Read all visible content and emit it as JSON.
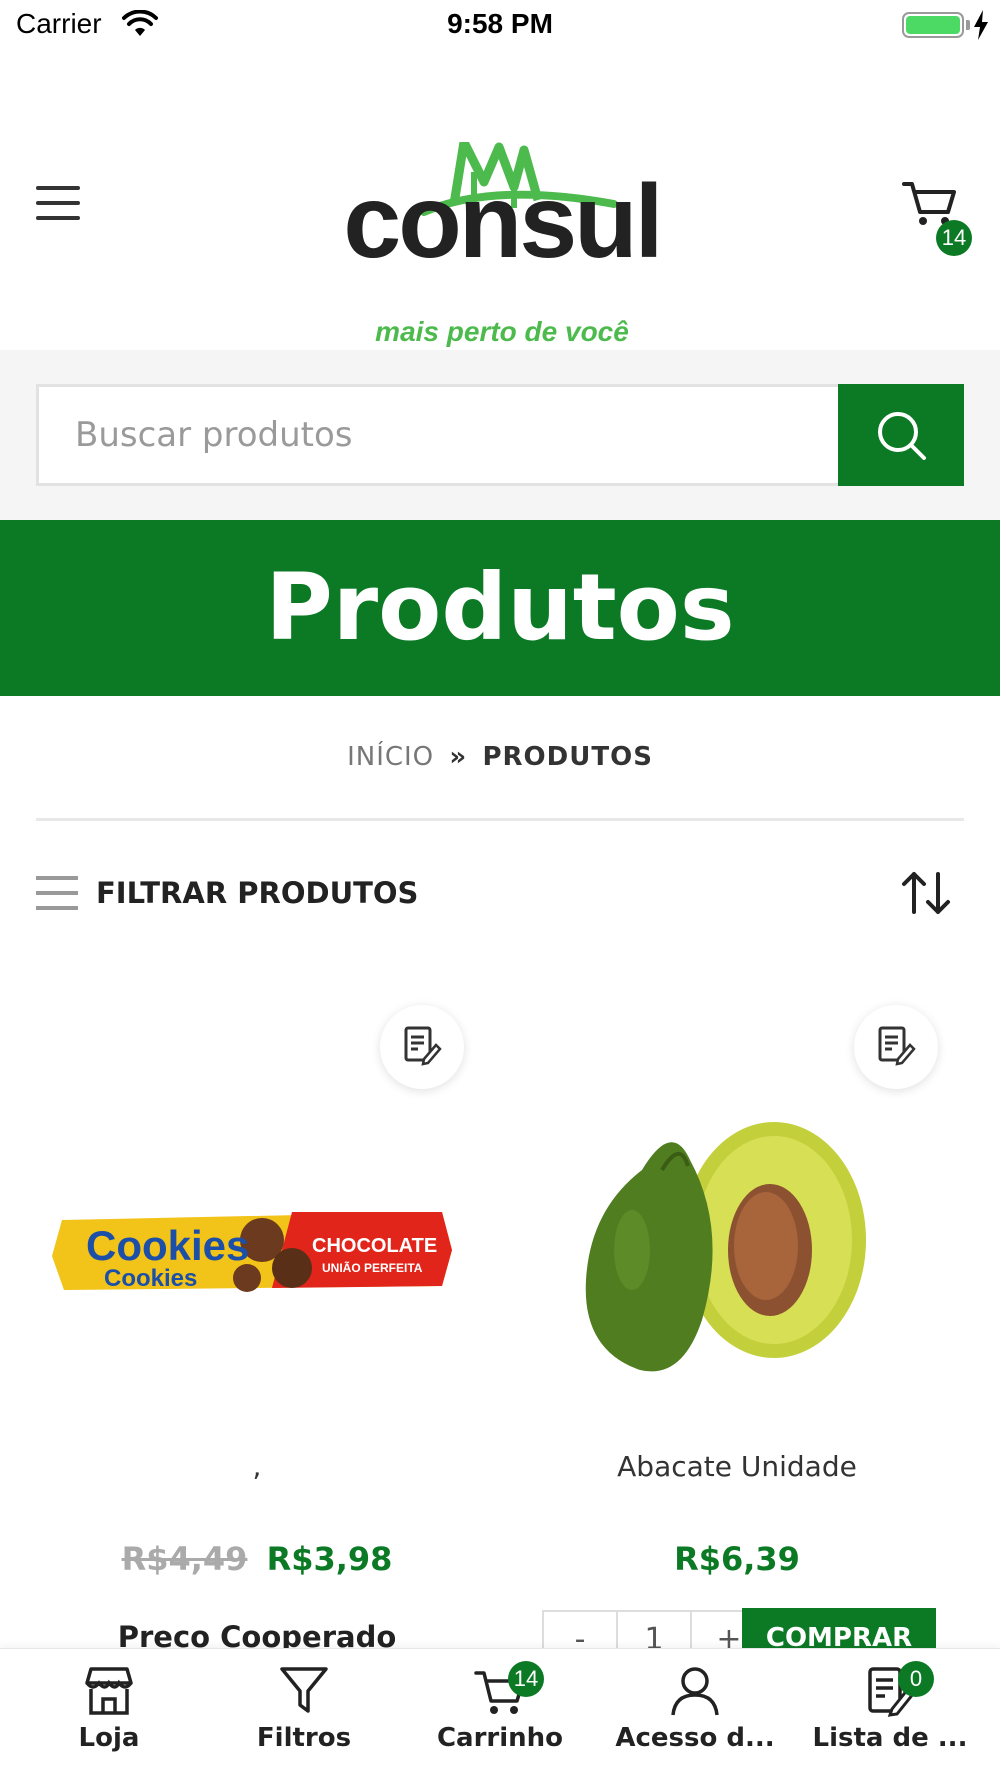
{
  "status_bar": {
    "carrier": "Carrier",
    "time": "9:58 PM"
  },
  "header": {
    "logo_text": "consul",
    "logo_tagline": "mais perto de você",
    "cart_count": "14"
  },
  "search": {
    "placeholder": "Buscar produtos"
  },
  "banner": {
    "title": "Produtos"
  },
  "breadcrumb": {
    "home": "INÍCIO",
    "separator": "»",
    "current": "PRODUTOS"
  },
  "filter": {
    "label": "FILTRAR PRODUTOS"
  },
  "products": [
    {
      "name": ",",
      "old_price": "R$4,49",
      "price": "R$3,98",
      "promo_label": "Preco Cooperado",
      "image": "cookies-package"
    },
    {
      "name": "Abacate Unidade",
      "price": "R$6,39",
      "qty_minus": "-",
      "qty_value": "1",
      "qty_plus": "+",
      "buy_label": "COMPRAR",
      "image": "avocado"
    }
  ],
  "tab_bar": [
    {
      "label": "Loja",
      "icon": "store-icon"
    },
    {
      "label": "Filtros",
      "icon": "filter-icon"
    },
    {
      "label": "Carrinho",
      "icon": "cart-icon",
      "badge": "14"
    },
    {
      "label": "Acesso d...",
      "icon": "user-icon"
    },
    {
      "label": "Lista de ...",
      "icon": "list-icon",
      "badge": "0"
    }
  ],
  "colors": {
    "brand_green": "#0c7a25",
    "logo_green": "#4cba4c",
    "battery_green": "#4cd964"
  }
}
